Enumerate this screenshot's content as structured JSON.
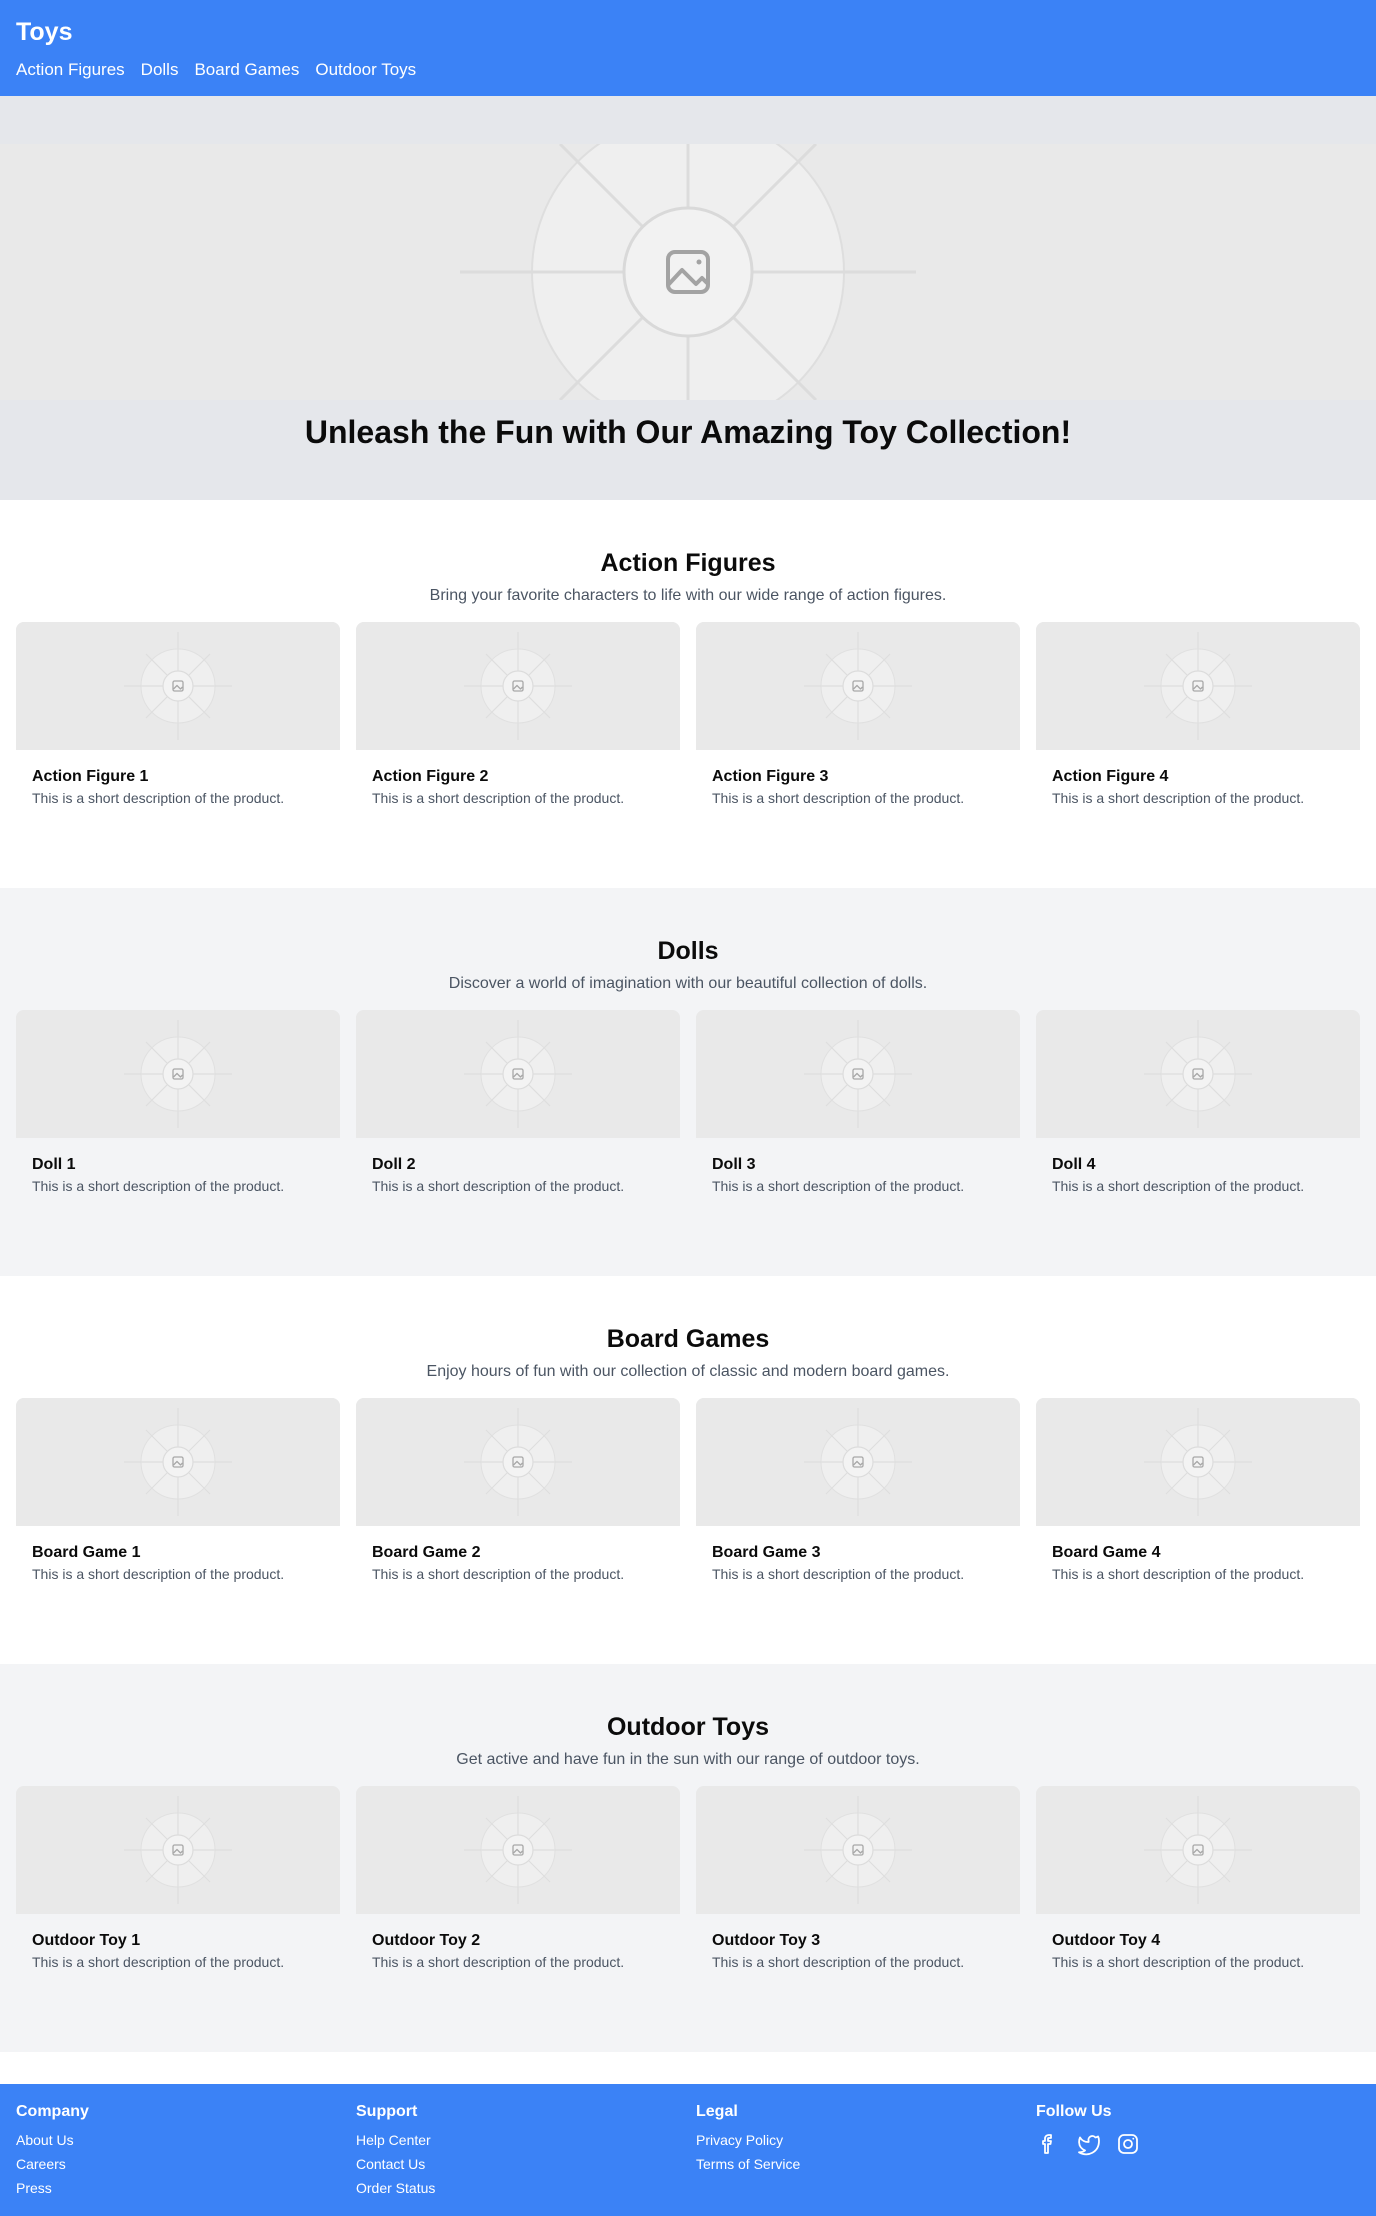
{
  "header": {
    "brand": "Toys",
    "nav": [
      "Action Figures",
      "Dolls",
      "Board Games",
      "Outdoor Toys"
    ]
  },
  "hero": {
    "image_icon": "image-placeholder-icon",
    "title": "Unleash the Fun with Our Amazing Toy Collection!"
  },
  "categories": [
    {
      "title": "Action Figures",
      "description": "Bring your favorite characters to life with our wide range of action figures.",
      "products": [
        {
          "name": "Action Figure 1",
          "description": "This is a short description of the product."
        },
        {
          "name": "Action Figure 2",
          "description": "This is a short description of the product."
        },
        {
          "name": "Action Figure 3",
          "description": "This is a short description of the product."
        },
        {
          "name": "Action Figure 4",
          "description": "This is a short description of the product."
        }
      ]
    },
    {
      "title": "Dolls",
      "description": "Discover a world of imagination with our beautiful collection of dolls.",
      "products": [
        {
          "name": "Doll 1",
          "description": "This is a short description of the product."
        },
        {
          "name": "Doll 2",
          "description": "This is a short description of the product."
        },
        {
          "name": "Doll 3",
          "description": "This is a short description of the product."
        },
        {
          "name": "Doll 4",
          "description": "This is a short description of the product."
        }
      ]
    },
    {
      "title": "Board Games",
      "description": "Enjoy hours of fun with our collection of classic and modern board games.",
      "products": [
        {
          "name": "Board Game 1",
          "description": "This is a short description of the product."
        },
        {
          "name": "Board Game 2",
          "description": "This is a short description of the product."
        },
        {
          "name": "Board Game 3",
          "description": "This is a short description of the product."
        },
        {
          "name": "Board Game 4",
          "description": "This is a short description of the product."
        }
      ]
    },
    {
      "title": "Outdoor Toys",
      "description": "Get active and have fun in the sun with our range of outdoor toys.",
      "products": [
        {
          "name": "Outdoor Toy 1",
          "description": "This is a short description of the product."
        },
        {
          "name": "Outdoor Toy 2",
          "description": "This is a short description of the product."
        },
        {
          "name": "Outdoor Toy 3",
          "description": "This is a short description of the product."
        },
        {
          "name": "Outdoor Toy 4",
          "description": "This is a short description of the product."
        }
      ]
    }
  ],
  "footer": {
    "columns": [
      {
        "heading": "Company",
        "links": [
          "About Us",
          "Careers",
          "Press"
        ]
      },
      {
        "heading": "Support",
        "links": [
          "Help Center",
          "Contact Us",
          "Order Status"
        ]
      },
      {
        "heading": "Legal",
        "links": [
          "Privacy Policy",
          "Terms of Service"
        ]
      }
    ],
    "social": {
      "heading": "Follow Us",
      "icons": [
        "facebook-icon",
        "twitter-icon",
        "instagram-icon"
      ]
    }
  },
  "colors": {
    "brand_blue": "#3b82f6",
    "hero_bg": "#e5e7eb",
    "alt_section_bg": "#f3f4f6",
    "muted_text": "#4b5563"
  }
}
